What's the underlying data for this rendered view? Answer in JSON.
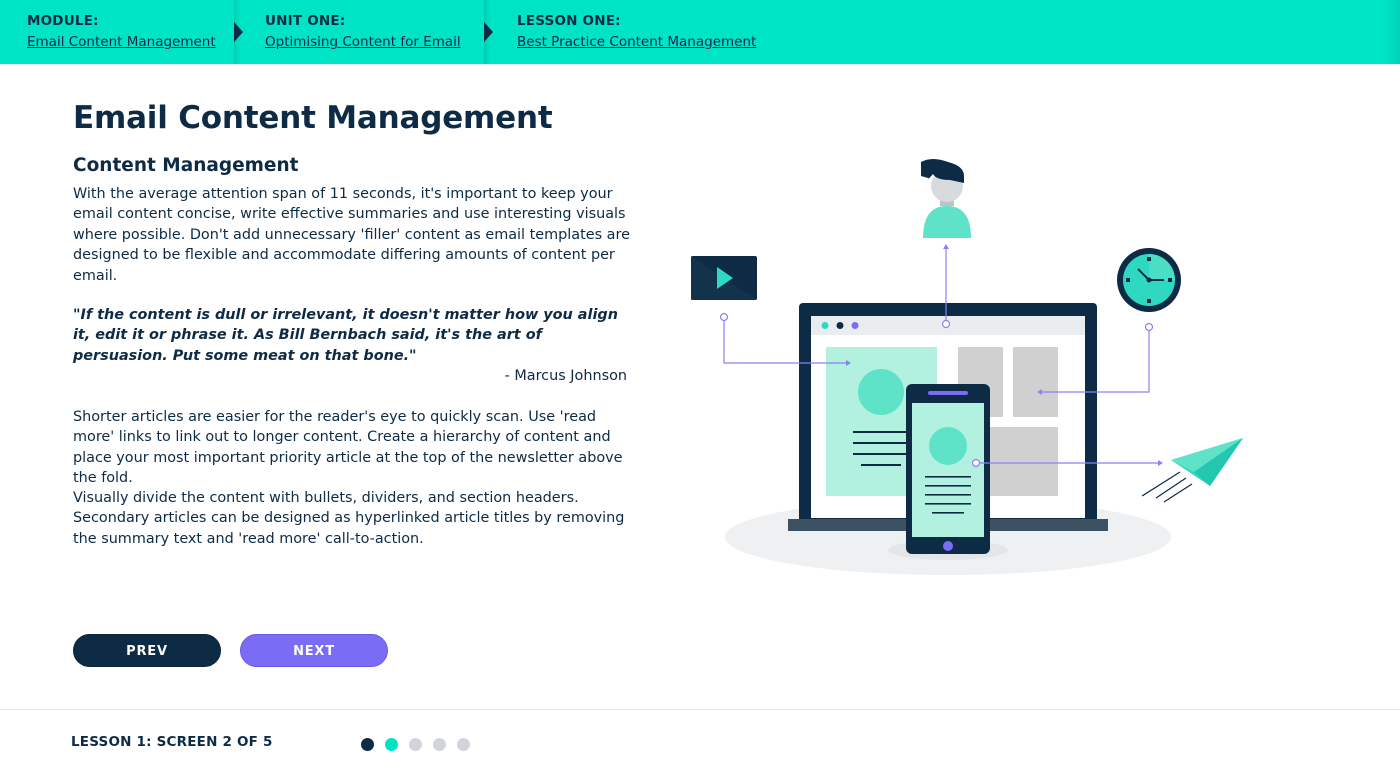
{
  "breadcrumb": [
    {
      "label": "MODULE:",
      "link": "Email Content Management"
    },
    {
      "label": "UNIT ONE:",
      "link": "Optimising Content for Email"
    },
    {
      "label": "LESSON ONE:",
      "link": "Best Practice Content Management"
    }
  ],
  "page": {
    "title": "Email Content Management",
    "subtitle": "Content Management",
    "paragraph1": "With the average attention span of 11 seconds, it's important to keep your email content concise, write effective summaries and use interesting visuals where possible. Don't add unnecessary 'filler' content as email templates are designed to be flexible and accommodate differing amounts of content per email.",
    "quote": "\"If the content is dull or irrelevant, it doesn't matter how you align it, edit it or phrase it. As Bill Bernbach said, it's the art of persuasion. Put some meat on that bone.\"",
    "quote_author": "- Marcus Johnson",
    "paragraph2": "Shorter articles are easier for the reader's eye to quickly scan. Use 'read more' links to link out to longer content. Create a hierarchy of content and place your most important priority article at the top of the newsletter above the fold.",
    "paragraph3": "Visually divide the content with bullets, dividers, and section headers. Secondary articles can be designed as hyperlinked article titles by removing the summary text and 'read more' call-to-action."
  },
  "nav": {
    "prev_label": "PREV",
    "next_label": "NEXT"
  },
  "footer": {
    "screen_label": "LESSON 1: SCREEN 2 OF 5",
    "current_screen": 2,
    "total_screens": 5
  },
  "colors": {
    "accent": "#00e4c6",
    "navy": "#0d2b45",
    "purple": "#7b6cf6",
    "mint": "#b2f0e0",
    "inactive_dot": "#d1d4d8"
  },
  "illustration": {
    "icons": [
      "user-avatar-icon",
      "video-play-icon",
      "clock-icon",
      "laptop-icon",
      "smartphone-icon",
      "paper-plane-icon"
    ]
  }
}
